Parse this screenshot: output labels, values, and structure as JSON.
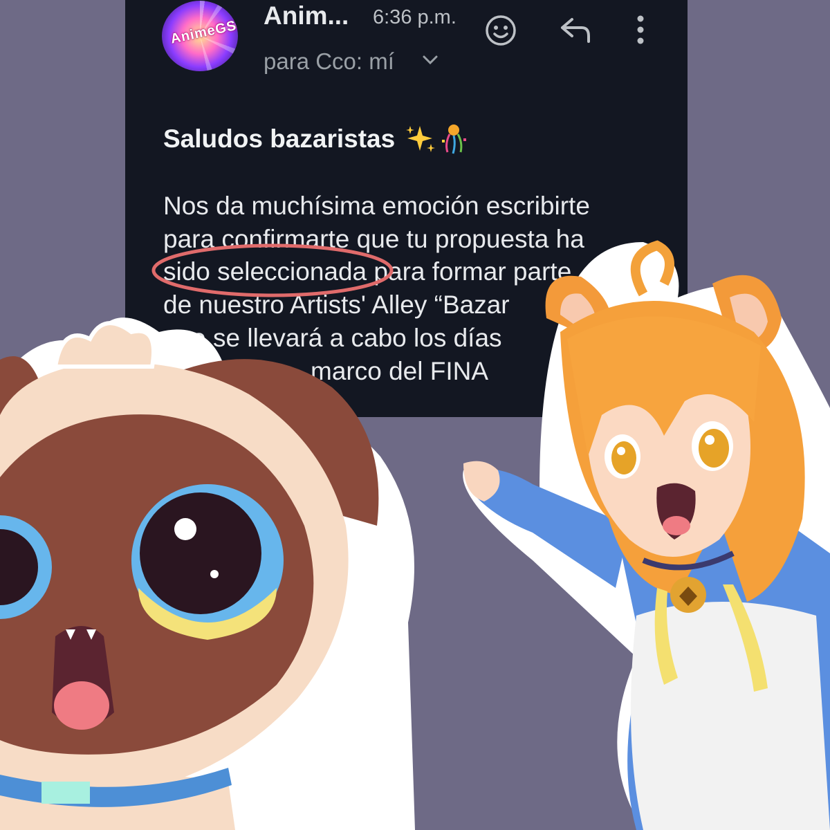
{
  "email": {
    "sender": "Anim...",
    "time": "6:36 p.m.",
    "recipient": "para Cco: mí",
    "avatar_logo_text": "AnimeGShow",
    "icons": {
      "emoji": "emoji-reaction-icon",
      "reply": "reply-icon",
      "more": "more-vert-icon",
      "recipient_toggle": "chevron-down-icon"
    },
    "greeting": "Saludos bazaristas",
    "greeting_emojis": [
      "sparkles-icon",
      "confetti-icon"
    ],
    "body_lines": [
      "Nos da muchísima emoción escribirte",
      "para confirmarte que tu propuesta ha",
      "sido seleccionada para formar parte",
      "de nuestro Artists' Alley “Bazar",
      "que se llevará a cabo los días",
      "marco del FINA"
    ],
    "highlighted_phrase": "sido seleccionada"
  },
  "characters": {
    "left": "siamese-cat-character",
    "right": "fox-eared-girl-character"
  },
  "colors": {
    "background": "#6e6a86",
    "email_bg": "#131722",
    "highlight_circle": "#e06b6b"
  }
}
